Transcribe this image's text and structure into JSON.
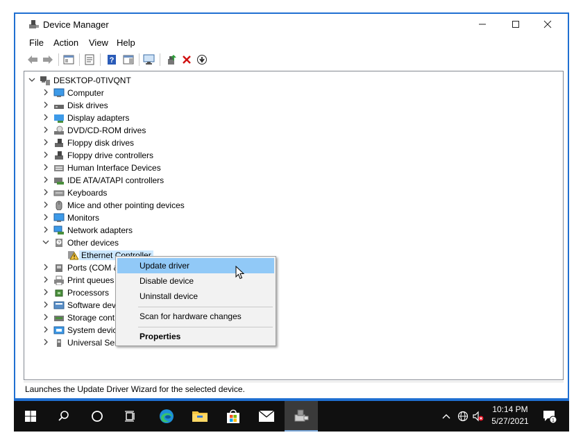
{
  "window": {
    "title": "Device Manager",
    "controls": {
      "minimize": "—",
      "maximize": "☐",
      "close": "✕"
    }
  },
  "menu": [
    "File",
    "Action",
    "View",
    "Help"
  ],
  "toolbar": {
    "icons": [
      "back-arrow-icon",
      "forward-arrow-icon",
      "show-hide-console-tree-icon",
      "properties-icon",
      "help-icon",
      "show-action-pane-icon",
      "scan-hardware-changes-icon",
      "update-driver-icon",
      "uninstall-device-icon",
      "disable-device-icon"
    ]
  },
  "tree": {
    "root": "DESKTOP-0TIVQNT",
    "categories": [
      {
        "label": "Computer",
        "icon": "computer-icon",
        "expanded": false
      },
      {
        "label": "Disk drives",
        "icon": "disk-drive-icon",
        "expanded": false
      },
      {
        "label": "Display adapters",
        "icon": "display-adapter-icon",
        "expanded": false
      },
      {
        "label": "DVD/CD-ROM drives",
        "icon": "dvd-drive-icon",
        "expanded": false
      },
      {
        "label": "Floppy disk drives",
        "icon": "floppy-disk-icon",
        "expanded": false
      },
      {
        "label": "Floppy drive controllers",
        "icon": "floppy-controller-icon",
        "expanded": false
      },
      {
        "label": "Human Interface Devices",
        "icon": "hid-icon",
        "expanded": false
      },
      {
        "label": "IDE ATA/ATAPI controllers",
        "icon": "ide-controller-icon",
        "expanded": false
      },
      {
        "label": "Keyboards",
        "icon": "keyboard-icon",
        "expanded": false
      },
      {
        "label": "Mice and other pointing devices",
        "icon": "mouse-icon",
        "expanded": false
      },
      {
        "label": "Monitors",
        "icon": "monitor-icon",
        "expanded": false
      },
      {
        "label": "Network adapters",
        "icon": "network-adapter-icon",
        "expanded": false
      },
      {
        "label": "Other devices",
        "icon": "unknown-device-icon",
        "expanded": true,
        "children": [
          {
            "label": "Ethernet Controller",
            "icon": "warning-device-icon",
            "selected": true
          }
        ]
      },
      {
        "label": "Ports (COM &",
        "icon": "port-icon",
        "expanded": false
      },
      {
        "label": "Print queues",
        "icon": "printer-icon",
        "expanded": false
      },
      {
        "label": "Processors",
        "icon": "processor-icon",
        "expanded": false
      },
      {
        "label": "Software dev",
        "icon": "software-device-icon",
        "expanded": false
      },
      {
        "label": "Storage cont",
        "icon": "storage-controller-icon",
        "expanded": false
      },
      {
        "label": "System devic",
        "icon": "system-device-icon",
        "expanded": false
      },
      {
        "label": "Universal Ser",
        "icon": "usb-icon",
        "expanded": false
      }
    ]
  },
  "context_menu": {
    "update_driver": "Update driver",
    "disable_device": "Disable device",
    "uninstall_device": "Uninstall device",
    "scan_hardware": "Scan for hardware changes",
    "properties": "Properties"
  },
  "status_bar": "Launches the Update Driver Wizard for the selected device.",
  "taskbar": {
    "apps": [
      "start-icon",
      "search-icon",
      "cortana-icon",
      "task-view-icon",
      "edge-icon",
      "file-explorer-icon",
      "store-icon",
      "mail-icon",
      "device-manager-icon"
    ],
    "time": "10:14 PM",
    "date": "5/27/2021",
    "notification_count": "1"
  },
  "colors": {
    "accent": "#1f6fd1",
    "selection": "#cce8ff",
    "menu_highlight": "#91c9f7",
    "taskbar": "#101010"
  }
}
